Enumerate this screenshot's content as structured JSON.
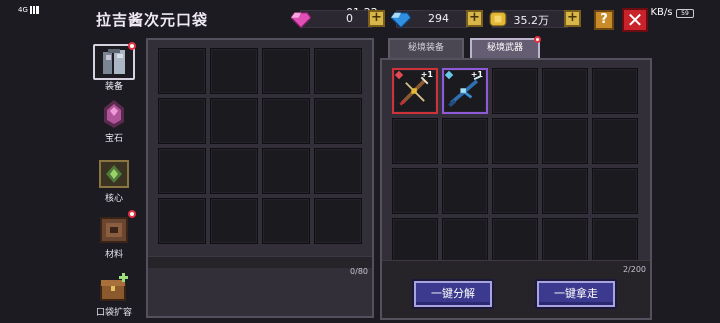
{
  "status_bar": {
    "clock": "01:22",
    "net_speed": "0.30 KB/s",
    "signal_label": "4G",
    "battery": "59"
  },
  "header": {
    "title": "拉吉酱次元口袋",
    "pink_gems": "0",
    "blue_gems": "294",
    "gold": "35.2万",
    "help_label": "?",
    "close_label": "✕",
    "plus_label": "+"
  },
  "sidebar": {
    "items": [
      {
        "label": "装备",
        "icon": "armor-icon",
        "active": true,
        "badge": true
      },
      {
        "label": "宝石",
        "icon": "gem-icon",
        "active": false,
        "badge": false
      },
      {
        "label": "核心",
        "icon": "core-icon",
        "active": false,
        "badge": false
      },
      {
        "label": "材料",
        "icon": "material-icon",
        "active": false,
        "badge": true
      },
      {
        "label": "口袋扩容",
        "icon": "chest-icon",
        "active": false,
        "badge": false
      }
    ]
  },
  "left_panel": {
    "count": "0/80"
  },
  "right_panel": {
    "tabs": [
      {
        "label": "秘境装备",
        "active": false
      },
      {
        "label": "秘境武器",
        "active": true
      }
    ],
    "count": "2/200",
    "items": [
      {
        "name": "crossbow-weapon",
        "level": "+1",
        "rarity_color": "#d0323a"
      },
      {
        "name": "ice-rifle-weapon",
        "level": "+1",
        "rarity_color": "#8f5ad8"
      }
    ],
    "buttons": {
      "decompose_all": "一键分解",
      "take_all": "一键拿走"
    }
  },
  "colors": {
    "accent_button": "#3c3a8e",
    "close_red": "#c8222b",
    "badge_red": "#e23240"
  }
}
